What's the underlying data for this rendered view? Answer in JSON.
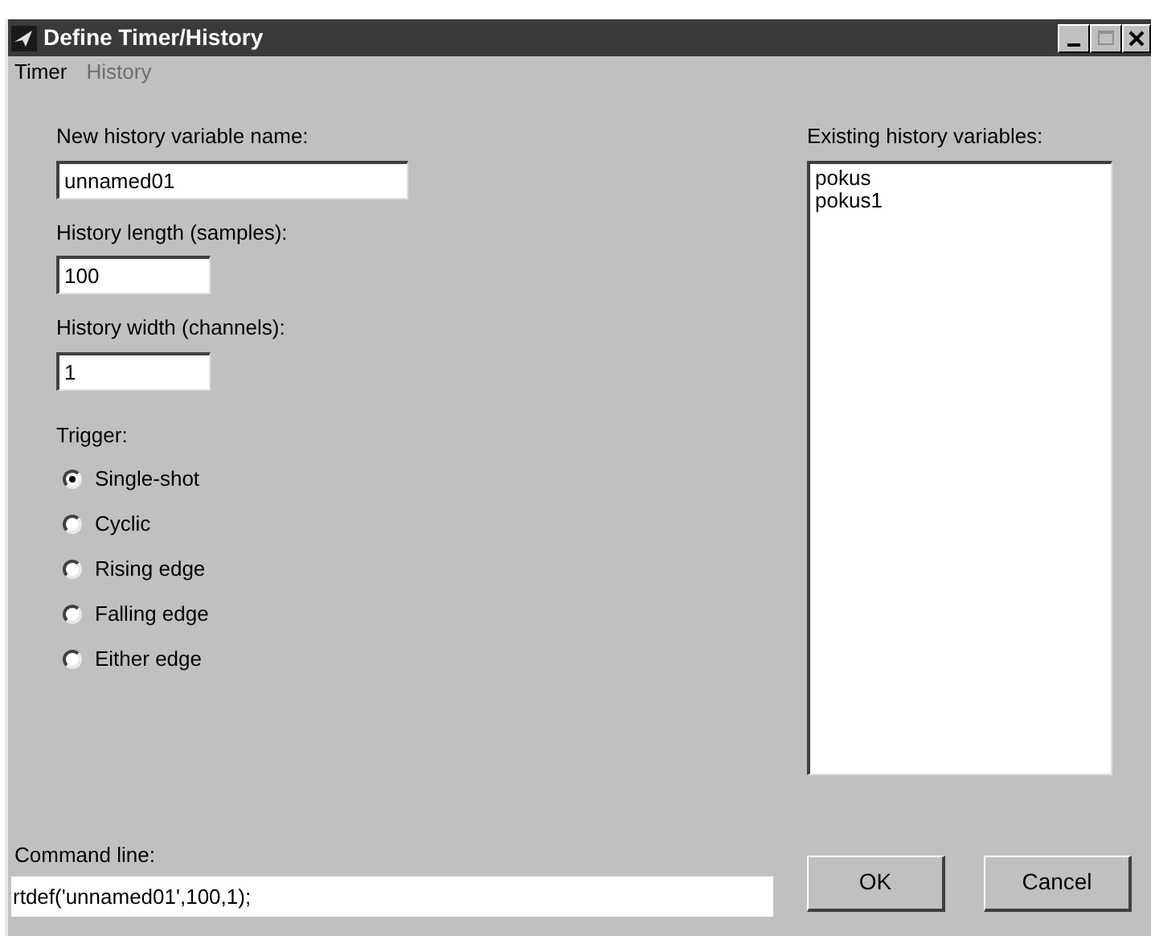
{
  "window": {
    "title": "Define Timer/History"
  },
  "menu": [
    {
      "label": "Timer",
      "disabled": false
    },
    {
      "label": "History",
      "disabled": true
    }
  ],
  "name_field": {
    "label": "New history variable name:",
    "value": "unnamed01"
  },
  "length_field": {
    "label": "History length (samples):",
    "value": "100"
  },
  "width_field": {
    "label": "History width (channels):",
    "value": "1"
  },
  "trigger": {
    "label": "Trigger:",
    "options": [
      {
        "label": "Single-shot",
        "selected": true
      },
      {
        "label": "Cyclic",
        "selected": false
      },
      {
        "label": "Rising edge",
        "selected": false
      },
      {
        "label": "Falling edge",
        "selected": false
      },
      {
        "label": "Either edge",
        "selected": false
      }
    ]
  },
  "existing": {
    "label": "Existing history variables:",
    "items": [
      "pokus",
      "pokus1"
    ]
  },
  "command": {
    "label": "Command line:",
    "value": "rtdef('unnamed01',100,1);"
  },
  "buttons": [
    "OK",
    "Cancel"
  ]
}
